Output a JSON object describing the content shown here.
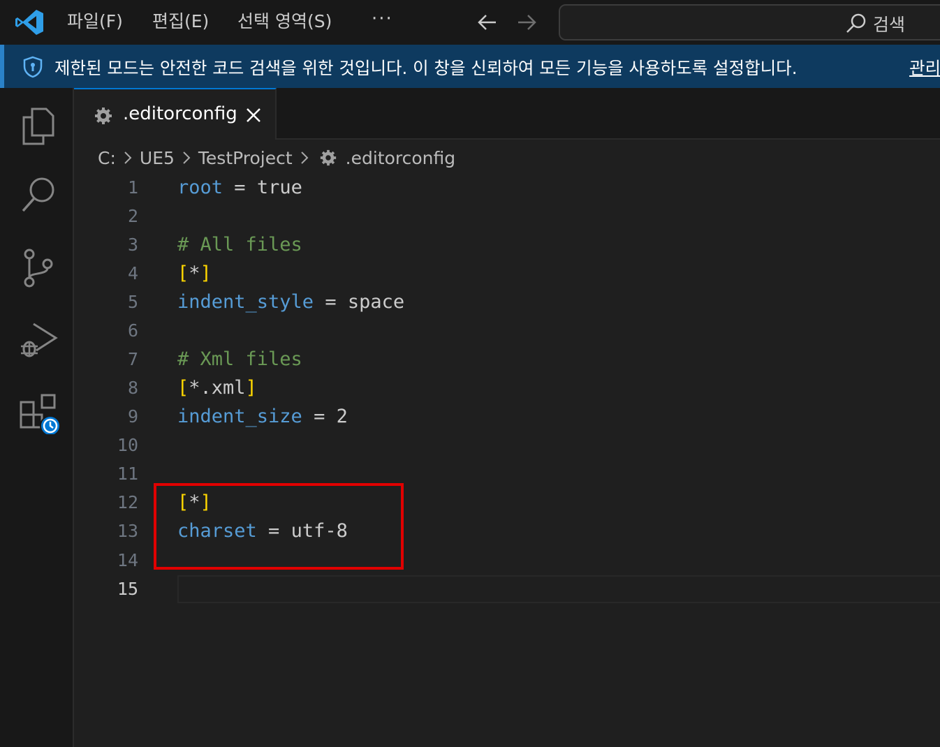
{
  "titlebar": {
    "menu": {
      "file": "파일(F)",
      "edit": "편집(E)",
      "selection": "선택 영역(S)",
      "more": "···"
    },
    "search_label": "검색"
  },
  "banner": {
    "message": "제한된 모드는 안전한 코드 검색을 위한 것입니다. 이 창을 신뢰하여 모든 기능을 사용하도록 설정합니다.",
    "manage_link": "관리"
  },
  "tab": {
    "label": ".editorconfig"
  },
  "breadcrumb": [
    "C:",
    "UE5",
    "TestProject",
    ".editorconfig"
  ],
  "editor": {
    "active_line": 15,
    "lines": [
      {
        "n": "1"
      },
      {
        "n": "2"
      },
      {
        "n": "3"
      },
      {
        "n": "4"
      },
      {
        "n": "5"
      },
      {
        "n": "6"
      },
      {
        "n": "7"
      },
      {
        "n": "8"
      },
      {
        "n": "9"
      },
      {
        "n": "10"
      },
      {
        "n": "11"
      },
      {
        "n": "12"
      },
      {
        "n": "13"
      },
      {
        "n": "14"
      },
      {
        "n": "15"
      }
    ],
    "tokens": {
      "l1_key": "root",
      "l1_eq": " = ",
      "l1_val": "true",
      "l3_comment": "# All files",
      "l4_open": "[",
      "l4_mid": "*",
      "l4_close": "]",
      "l5_key": "indent_style",
      "l5_eq": " = ",
      "l5_val": "space",
      "l7_comment": "# Xml files",
      "l8_open": "[",
      "l8_mid": "*.xml",
      "l8_close": "]",
      "l9_key": "indent_size",
      "l9_eq": " = ",
      "l9_val": "2",
      "l12_open": "[",
      "l12_mid": "*",
      "l12_close": "]",
      "l13_key": "charset",
      "l13_eq": " = ",
      "l13_val": "utf-8"
    }
  },
  "colors": {
    "accent": "#0078d4",
    "banner_bg": "#0e3a5f",
    "keyword": "#569cd6",
    "comment": "#6a9955",
    "bracket": "#ffd700",
    "highlight_box": "#e00000"
  }
}
